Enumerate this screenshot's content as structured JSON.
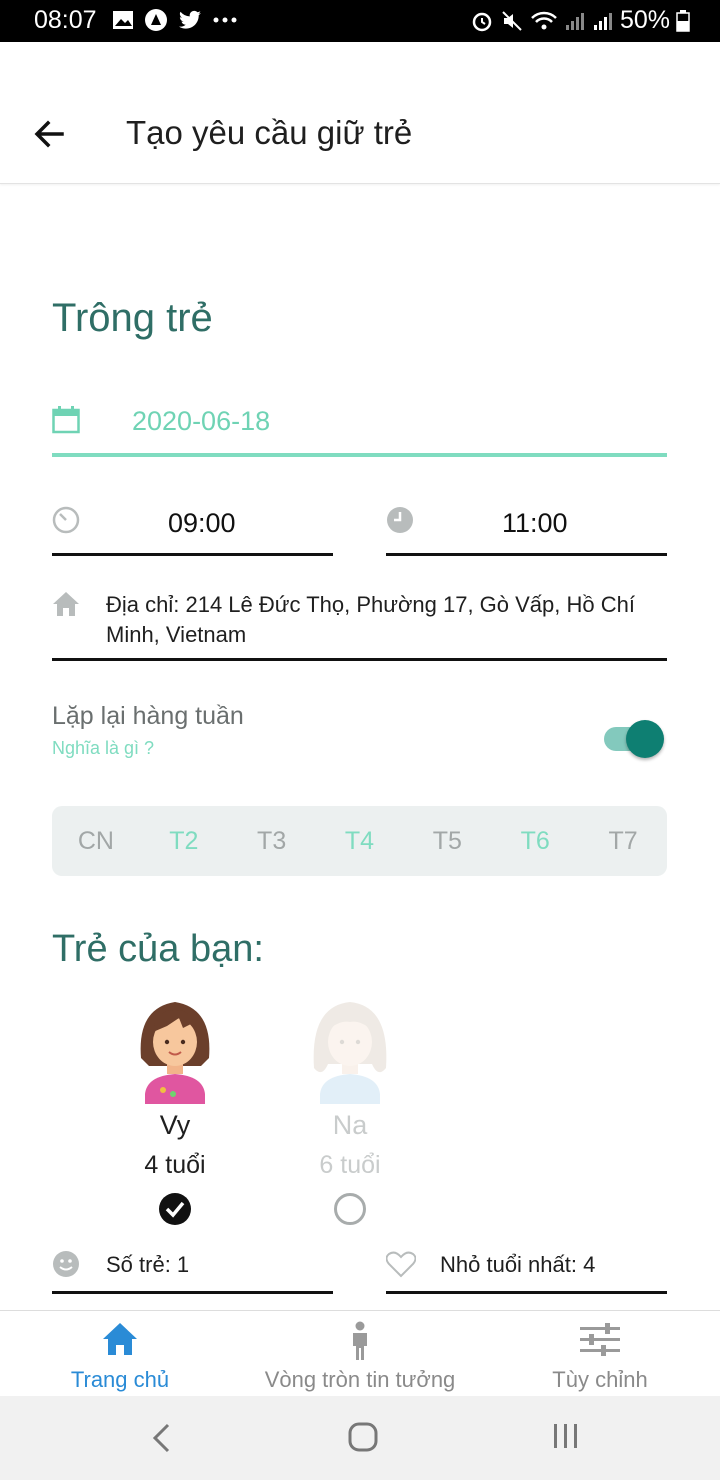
{
  "status_bar": {
    "time": "08:07",
    "battery": "50%"
  },
  "app_bar": {
    "title": "Tạo yêu cầu giữ trẻ"
  },
  "form": {
    "section_title": "Trông trẻ",
    "date_value": "2020-06-18",
    "start_time": "09:00",
    "end_time": "11:00",
    "address": "Địa chỉ: 214 Lê Đức Thọ, Phường 17, Gò Vấp, Hồ Chí Minh, Vietnam",
    "repeat_label": "Lặp lại hàng tuần",
    "repeat_help": "Nghĩa là gì ?",
    "repeat_enabled": true,
    "days": [
      {
        "label": "CN",
        "selected": false
      },
      {
        "label": "T2",
        "selected": true
      },
      {
        "label": "T3",
        "selected": false
      },
      {
        "label": "T4",
        "selected": true
      },
      {
        "label": "T5",
        "selected": false
      },
      {
        "label": "T6",
        "selected": true
      },
      {
        "label": "T7",
        "selected": false
      }
    ]
  },
  "children_section": {
    "title": "Trẻ của bạn:",
    "children": [
      {
        "name": "Vy",
        "age": "4 tuổi",
        "selected": true
      },
      {
        "name": "Na",
        "age": "6 tuổi",
        "selected": false
      }
    ],
    "count_label": "Số trẻ: 1",
    "youngest_label": "Nhỏ tuổi nhất: 4"
  },
  "bottom_nav": {
    "items": [
      {
        "label": "Trang chủ",
        "icon": "home-icon",
        "active": true
      },
      {
        "label": "Vòng tròn tin tưởng",
        "icon": "person-icon",
        "active": false
      },
      {
        "label": "Tùy chỉnh",
        "icon": "sliders-icon",
        "active": false
      }
    ]
  },
  "colors": {
    "accent_teal": "#6fd3b4",
    "title_teal": "#2f6e66",
    "toggle_on": "#0e7f72",
    "nav_active": "#2a8bd6",
    "nav_inactive": "#9a9a9a"
  }
}
